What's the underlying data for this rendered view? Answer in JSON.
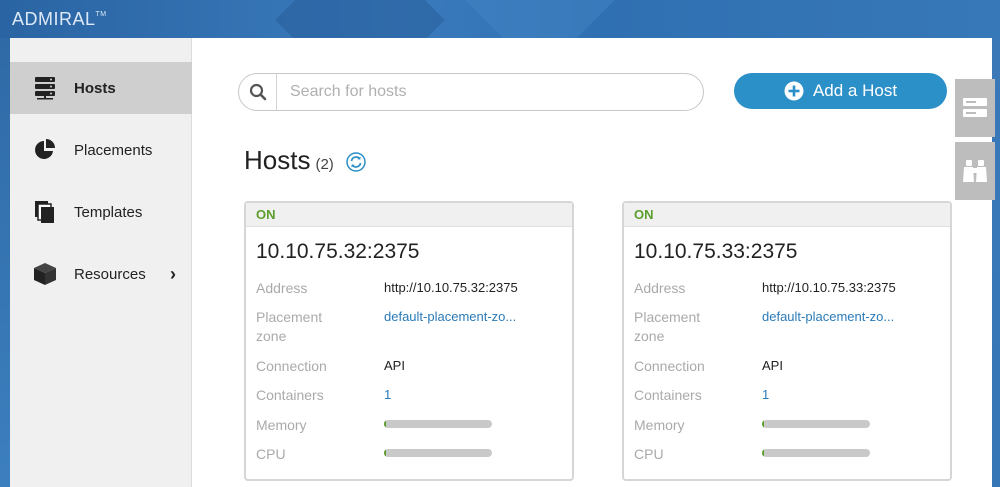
{
  "app": {
    "title": "ADMIRAL",
    "trademark": "TM"
  },
  "sidebar": {
    "items": [
      {
        "label": "Hosts",
        "icon": "server-stack-icon",
        "active": true
      },
      {
        "label": "Placements",
        "icon": "pie-chart-icon",
        "active": false
      },
      {
        "label": "Templates",
        "icon": "documents-icon",
        "active": false
      },
      {
        "label": "Resources",
        "icon": "cube-icon",
        "active": false,
        "has_submenu": true
      }
    ]
  },
  "search": {
    "placeholder": "Search for hosts",
    "value": ""
  },
  "toolbar": {
    "add_label": "Add a Host"
  },
  "page": {
    "title": "Hosts",
    "count": "(2)"
  },
  "hosts": [
    {
      "status": "ON",
      "name": "10.10.75.32:2375",
      "address_label": "Address",
      "address": "http://10.10.75.32:2375",
      "placement_label_1": "Placement",
      "placement_label_2": "zone",
      "placement": "default-placement-zo...",
      "connection_label": "Connection",
      "connection": "API",
      "containers_label": "Containers",
      "containers": "1",
      "memory_label": "Memory",
      "memory_usage": 0.02,
      "cpu_label": "CPU",
      "cpu_usage": 0.02
    },
    {
      "status": "ON",
      "name": "10.10.75.33:2375",
      "address_label": "Address",
      "address": "http://10.10.75.33:2375",
      "placement_label_1": "Placement",
      "placement_label_2": "zone",
      "placement": "default-placement-zo...",
      "connection_label": "Connection",
      "connection": "API",
      "containers_label": "Containers",
      "containers": "1",
      "memory_label": "Memory",
      "memory_usage": 0.02,
      "cpu_label": "CPU",
      "cpu_usage": 0.02
    }
  ],
  "right_tabs": [
    {
      "icon": "server-panel-icon"
    },
    {
      "icon": "binoculars-icon"
    }
  ],
  "colors": {
    "accent": "#2b8fc8",
    "status_on": "#5c9e2e",
    "link": "#2a7ab8"
  }
}
